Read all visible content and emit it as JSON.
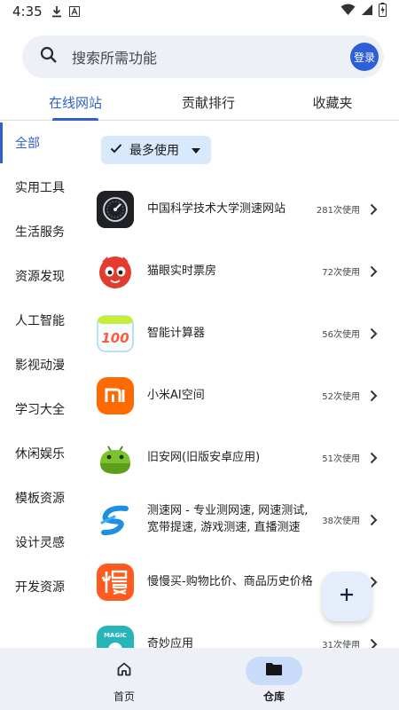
{
  "status_bar": {
    "time": "4:35",
    "icons": [
      "download-icon",
      "font-a-icon",
      "wifi-icon",
      "signal-icon",
      "battery-charging-icon"
    ]
  },
  "search": {
    "placeholder": "搜索所需功能",
    "login_label": "登录",
    "icon": "search-icon"
  },
  "tabs": [
    {
      "label": "在线网站",
      "active": true
    },
    {
      "label": "贡献排行",
      "active": false
    },
    {
      "label": "收藏夹",
      "active": false
    }
  ],
  "sidebar": {
    "items": [
      {
        "label": "全部",
        "active": true
      },
      {
        "label": "实用工具"
      },
      {
        "label": "生活服务"
      },
      {
        "label": "资源发现"
      },
      {
        "label": "人工智能"
      },
      {
        "label": "影视动漫"
      },
      {
        "label": "学习大全"
      },
      {
        "label": "休闲娱乐"
      },
      {
        "label": "模板资源"
      },
      {
        "label": "设计灵感"
      },
      {
        "label": "开发资源"
      }
    ]
  },
  "filter": {
    "label": "最多使用",
    "icon": "check-icon"
  },
  "apps": [
    {
      "name": "中国科学技术大学测速网站",
      "count": "281次使用",
      "icon": "speedometer-icon"
    },
    {
      "name": "猫眼实时票房",
      "count": "72次使用",
      "icon": "maoyan-cat-icon"
    },
    {
      "name": "智能计算器",
      "count": "56次使用",
      "icon": "calculator-100-icon"
    },
    {
      "name": "小米AI空间",
      "count": "52次使用",
      "icon": "xiaomi-icon"
    },
    {
      "name": "旧安网(旧版安卓应用)",
      "count": "51次使用",
      "icon": "android-icon"
    },
    {
      "name": "测速网 - 专业测网速, 网速测试, 宽带提速, 游戏测速, 直播测速",
      "count": "38次使用",
      "icon": "speedtest-s-icon"
    },
    {
      "name": "慢慢买-购物比价、商品历史价格",
      "count": "",
      "icon": "manmanmai-icon"
    },
    {
      "name": "奇妙应用",
      "count": "31次使用",
      "icon": "magic-app-icon"
    }
  ],
  "fab": {
    "icon": "plus-icon"
  },
  "bottom_nav": [
    {
      "label": "首页",
      "icon": "home-icon",
      "active": false
    },
    {
      "label": "仓库",
      "icon": "folder-icon",
      "active": true
    }
  ],
  "colors": {
    "accent": "#2f62c9",
    "login": "#2f5fd6",
    "chip": "#d8e9fb",
    "nav_bg": "#edf1f7",
    "nav_pill": "#c8dcfa"
  }
}
